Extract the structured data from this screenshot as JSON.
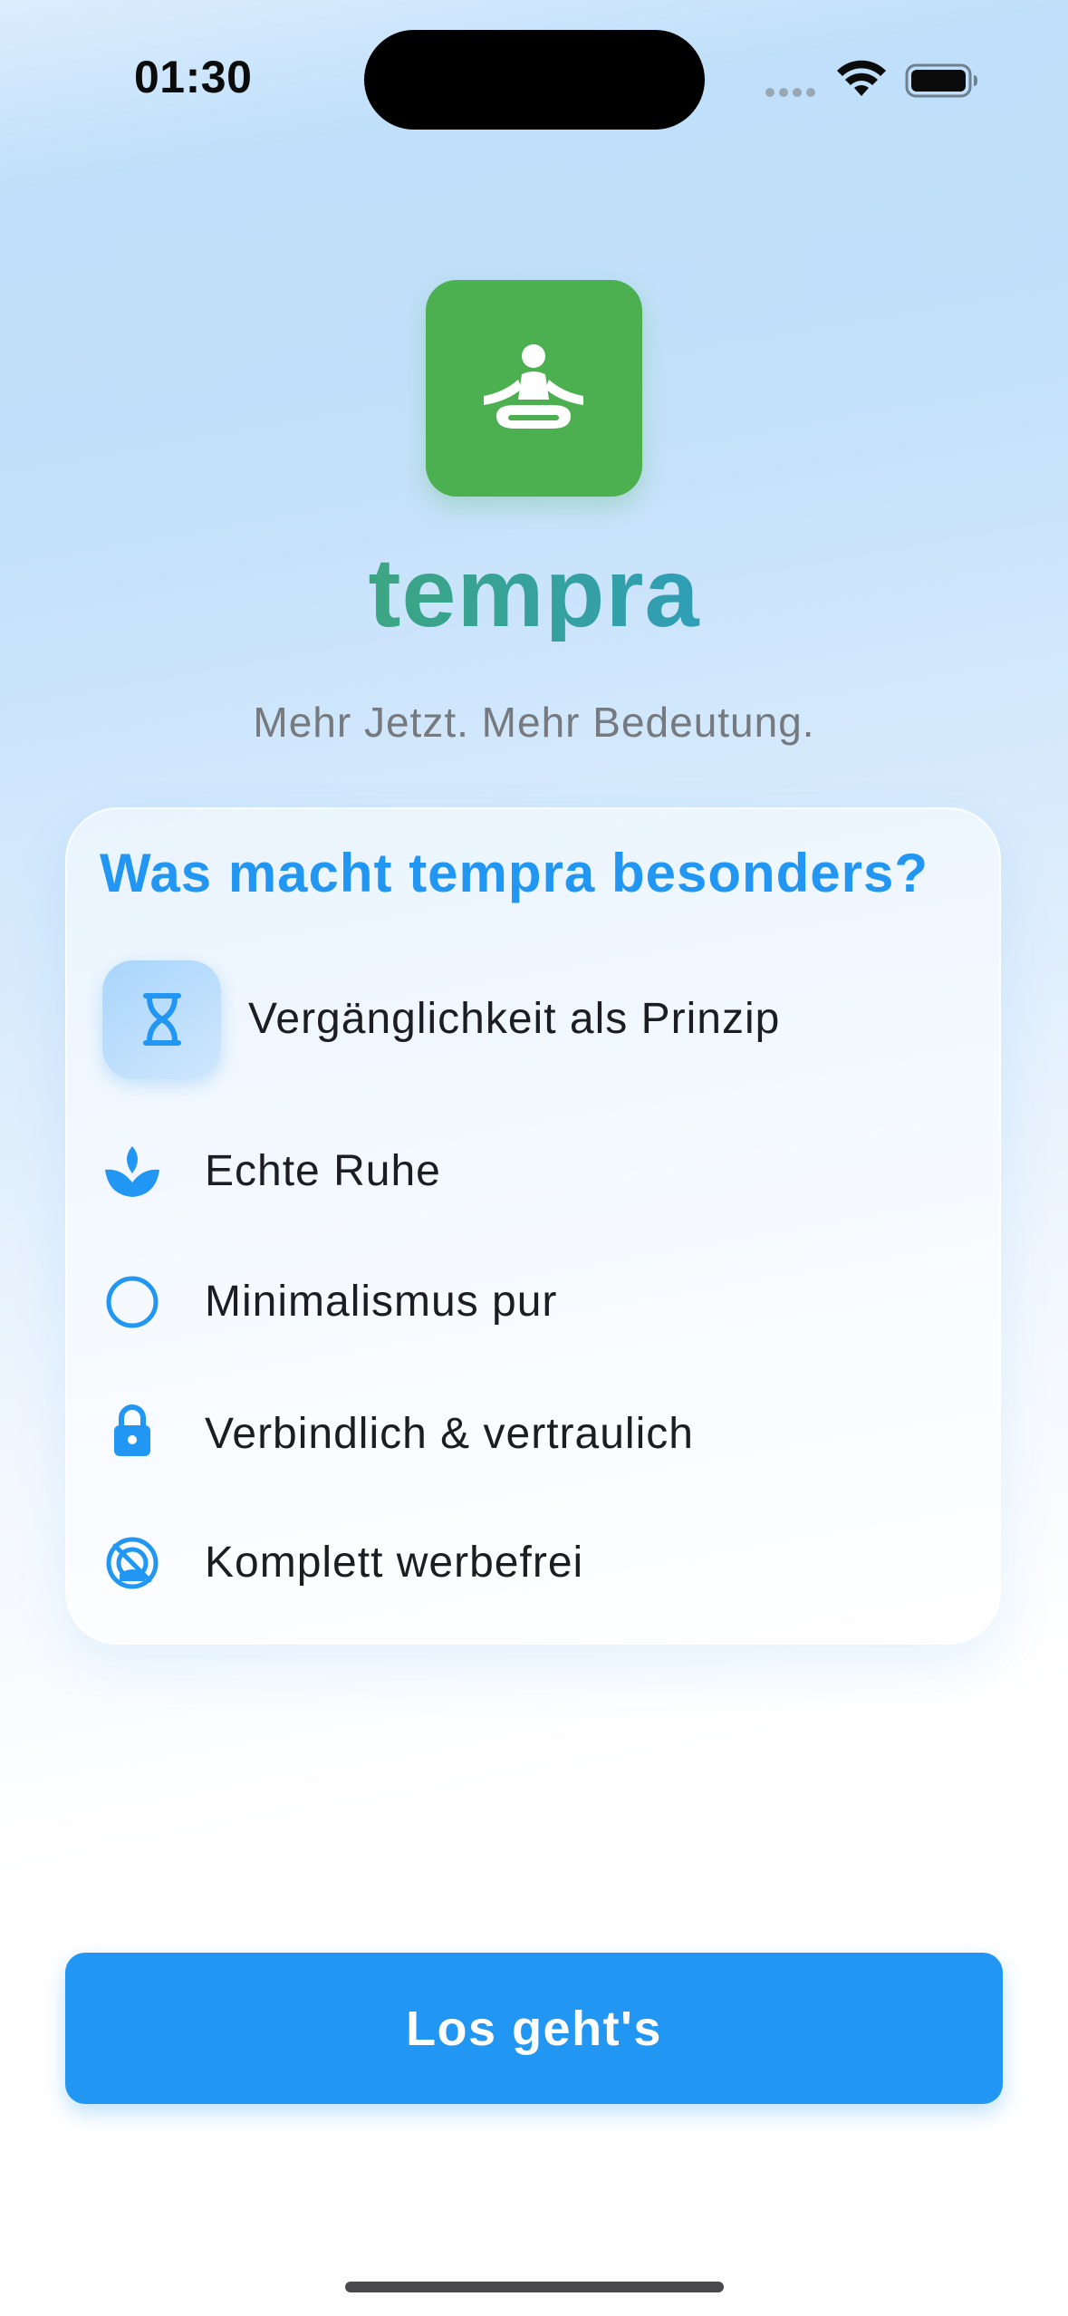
{
  "status_bar": {
    "time": "01:30"
  },
  "app": {
    "name": "tempra",
    "tagline": "Mehr Jetzt. Mehr Bedeutung.",
    "logo_icon": "meditation-person-icon",
    "logo_color": "#4caf50"
  },
  "features_card": {
    "title": "Was macht tempra besonders?",
    "items": [
      {
        "label": "Vergänglichkeit als Prinzip",
        "icon": "hourglass-icon",
        "highlighted": true
      },
      {
        "label": "Echte Ruhe",
        "icon": "spa-lotus-icon"
      },
      {
        "label": "Minimalismus pur",
        "icon": "circle-outline-icon"
      },
      {
        "label": "Verbindlich & vertraulich",
        "icon": "lock-icon"
      },
      {
        "label": "Komplett werbefrei",
        "icon": "no-ads-icon"
      }
    ]
  },
  "primary_action": {
    "label": "Los geht's"
  },
  "colors": {
    "accent": "#2196f3",
    "brand_green": "#4caf50",
    "text_dark": "#1b1d21",
    "text_muted": "#76797d"
  }
}
